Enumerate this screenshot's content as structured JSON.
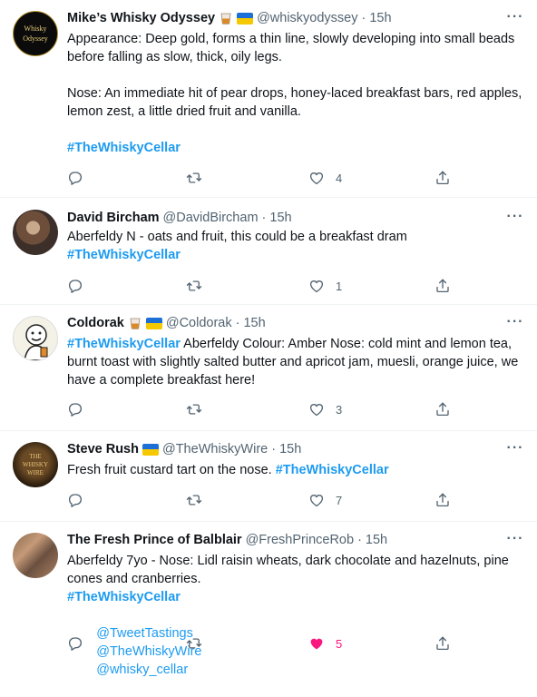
{
  "colors": {
    "link": "#1d9bf0",
    "muted": "#536471",
    "like_active": "#f91880"
  },
  "tweets": [
    {
      "name": "Mike’s Whisky Odyssey",
      "badges": [
        "whisky-glass-emoji",
        "ukraine-flag"
      ],
      "handle": "@whiskyodyssey",
      "dot": "·",
      "time": "15h",
      "avatar_text": [
        "Whisky",
        "Odyssey"
      ],
      "paragraphs": [
        "Appearance: Deep gold, forms a thin line, slowly developing into small beads before falling as slow, thick, oily legs.",
        "Nose: An immediate hit of pear drops, honey-laced breakfast bars, red apples, lemon zest, a little dried fruit and vanilla."
      ],
      "hashtag": "#TheWhiskyCellar",
      "likes": "4"
    },
    {
      "name": "David Bircham",
      "handle": "@DavidBircham",
      "dot": "·",
      "time": "15h",
      "text": "Aberfeldy N - oats and fruit, this could be a breakfast dram",
      "hashtag": "#TheWhiskyCellar",
      "likes": "1"
    },
    {
      "name": "Coldorak",
      "badges": [
        "whisky-glass-emoji",
        "ukraine-flag"
      ],
      "handle": "@Coldorak",
      "dot": "·",
      "time": "15h",
      "hashtag": "#TheWhiskyCellar",
      "text": " Aberfeldy Colour: Amber Nose: cold mint and lemon tea, burnt toast with slightly salted butter and apricot jam, muesli, orange juice, we have a complete breakfast here!",
      "likes": "3"
    },
    {
      "name": "Steve Rush",
      "badges": [
        "ukraine-flag"
      ],
      "handle": "@TheWhiskyWire",
      "dot": "·",
      "time": "15h",
      "avatar_text": [
        "THE",
        "WHISKY",
        "WIRE"
      ],
      "text": "Fresh fruit custard tart on the nose. ",
      "hashtag": "#TheWhiskyCellar",
      "likes": "7"
    },
    {
      "name": "The Fresh Prince of Balblair",
      "handle": "@FreshPrinceRob",
      "dot": "·",
      "time": "15h",
      "text": "Aberfeldy 7yo - Nose: Lidl raisin wheats, dark chocolate and hazelnuts, pine cones and cranberries.",
      "hashtag": "#TheWhiskyCellar",
      "mentions": [
        "@TweetTastings",
        "@TheWhiskyWire",
        "@whisky_cellar"
      ],
      "likes": "5",
      "liked": true
    }
  ]
}
